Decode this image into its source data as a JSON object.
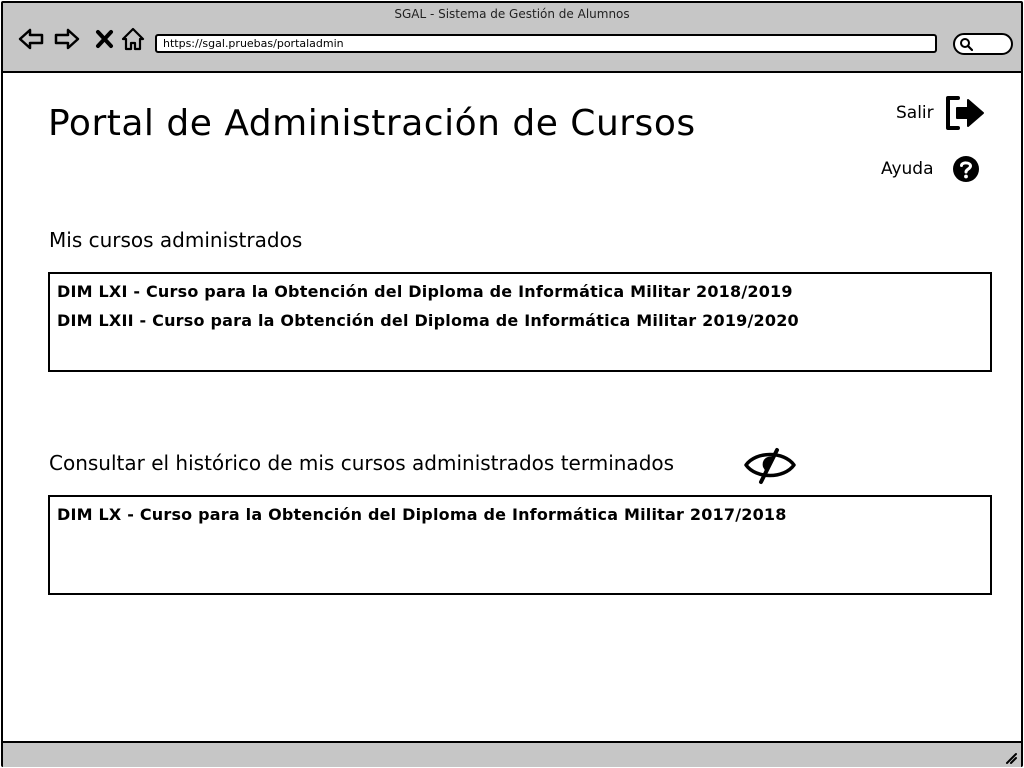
{
  "window": {
    "title": "SGAL - Sistema de Gestión de Alumnos"
  },
  "browser": {
    "url": "https://sgal.pruebas/portaladmin",
    "nav_icons": [
      "back-arrow-icon",
      "forward-arrow-icon",
      "close-x-icon",
      "home-icon"
    ],
    "search_icon": "search-icon"
  },
  "page": {
    "title": "Portal de Administración de Cursos",
    "salir_label": "Salir",
    "ayuda_label": "Ayuda"
  },
  "current_courses": {
    "heading": "Mis cursos administrados",
    "items": [
      "DIM LXI - Curso para la Obtención del Diploma de Informática Militar 2018/2019",
      "DIM LXII - Curso para la Obtención del Diploma de Informática Militar 2019/2020"
    ]
  },
  "history": {
    "heading": "Consultar el histórico de mis cursos administrados terminados",
    "toggle_icon": "eye-hidden-icon",
    "items": [
      "DIM LX - Curso para la Obtención del Diploma de Informática Militar 2017/2018"
    ]
  }
}
